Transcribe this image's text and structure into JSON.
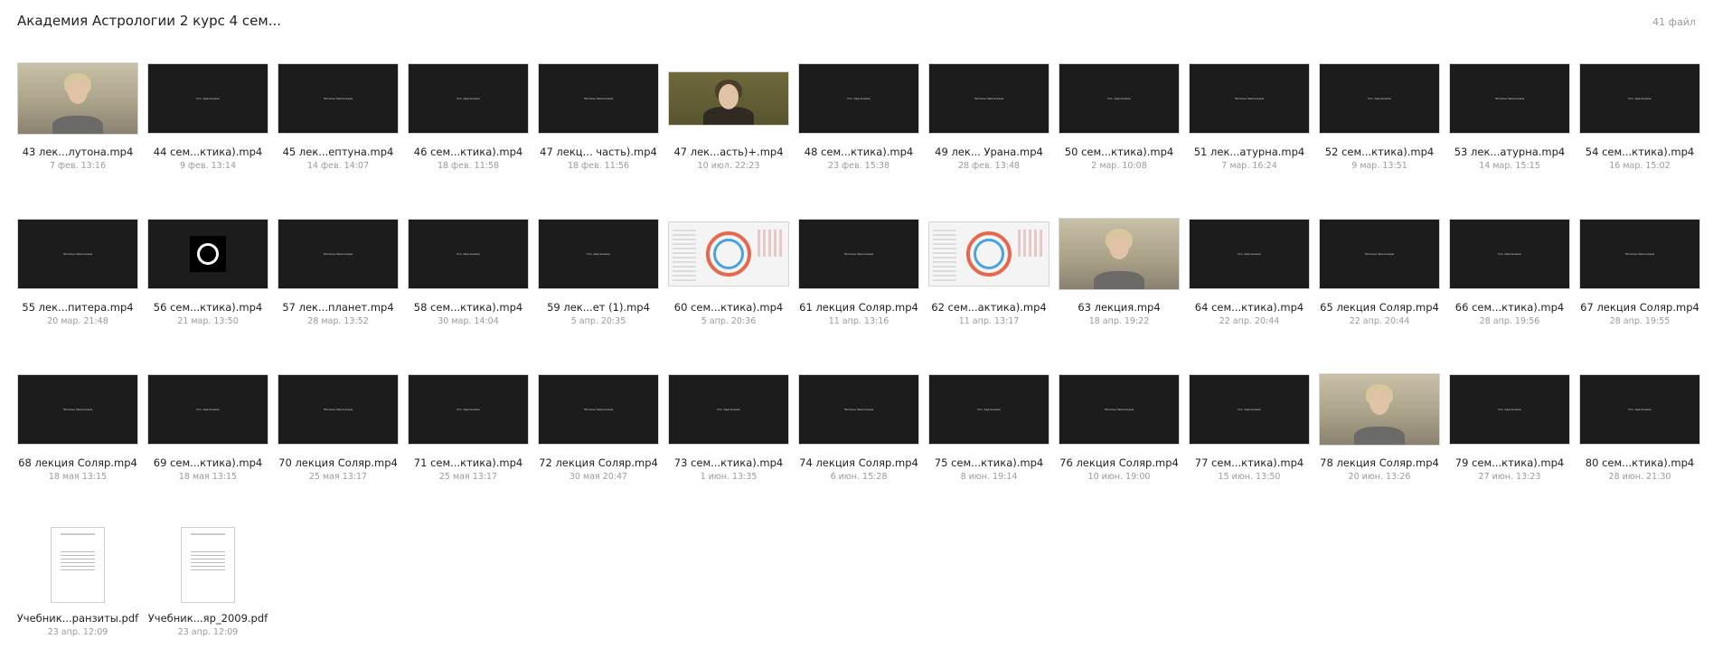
{
  "header": {
    "title": "Академия Астрологии 2 курс 4 сем...",
    "file_count": "41 файл"
  },
  "caption_text": {
    "natalia": "Наталья Хвесечеяна",
    "sem": "Н.А. Хвесечеяна"
  },
  "files": [
    {
      "name": "43 лек...лутона.mp4",
      "date": "7 фев. 13:16",
      "thumb": "webcam"
    },
    {
      "name": "44 сем...ктика).mp4",
      "date": "9 фев. 13:14",
      "thumb": "dark",
      "caption": "sem"
    },
    {
      "name": "45 лек...ептуна.mp4",
      "date": "14 фев. 14:07",
      "thumb": "dark",
      "caption": "natalia"
    },
    {
      "name": "46 сем...ктика).mp4",
      "date": "18 фев. 11:58",
      "thumb": "dark",
      "caption": "sem"
    },
    {
      "name": "47 лекц... часть).mp4",
      "date": "18 фев. 11:56",
      "thumb": "dark",
      "caption": "natalia"
    },
    {
      "name": "47 лек...асть)+.mp4",
      "date": "10 июл. 22:23",
      "thumb": "webcam-dark"
    },
    {
      "name": "48 сем...ктика).mp4",
      "date": "23 фев. 15:38",
      "thumb": "dark",
      "caption": "sem"
    },
    {
      "name": "49 лек... Урана.mp4",
      "date": "28 фев. 13:48",
      "thumb": "dark",
      "caption": "natalia"
    },
    {
      "name": "50 сем...ктика).mp4",
      "date": "2 мар. 10:08",
      "thumb": "dark",
      "caption": "sem"
    },
    {
      "name": "51 лек...атурна.mp4",
      "date": "7 мар. 16:24",
      "thumb": "dark",
      "caption": "natalia"
    },
    {
      "name": "52 сем...ктика).mp4",
      "date": "9 мар. 13:51",
      "thumb": "dark",
      "caption": "sem"
    },
    {
      "name": "53 лек...атурна.mp4",
      "date": "14 мар. 15:15",
      "thumb": "dark",
      "caption": "natalia"
    },
    {
      "name": "54 сем...ктика).mp4",
      "date": "16 мар. 15:02",
      "thumb": "dark",
      "caption": "sem"
    },
    {
      "name": "55 лек...питера.mp4",
      "date": "20 мар. 21:48",
      "thumb": "dark",
      "caption": "natalia"
    },
    {
      "name": "56 сем...ктика).mp4",
      "date": "21 мар. 13:50",
      "thumb": "logo"
    },
    {
      "name": "57 лек...планет.mp4",
      "date": "28 мар. 13:52",
      "thumb": "dark",
      "caption": "natalia"
    },
    {
      "name": "58 сем...ктика).mp4",
      "date": "30 мар. 14:04",
      "thumb": "dark",
      "caption": "sem"
    },
    {
      "name": "59 лек...ет (1).mp4",
      "date": "5 апр. 20:35",
      "thumb": "dark",
      "caption": "sem"
    },
    {
      "name": "60 сем...ктика).mp4",
      "date": "5 апр. 20:36",
      "thumb": "chart"
    },
    {
      "name": "61 лекция Соляр.mp4",
      "date": "11 апр. 13:16",
      "thumb": "dark",
      "caption": "natalia"
    },
    {
      "name": "62 сем...актика).mp4",
      "date": "11 апр. 13:17",
      "thumb": "chart"
    },
    {
      "name": "63 лекция.mp4",
      "date": "18 апр. 19:22",
      "thumb": "webcam"
    },
    {
      "name": "64 сем...ктика).mp4",
      "date": "22 апр. 20:44",
      "thumb": "dark",
      "caption": "sem"
    },
    {
      "name": "65 лекция Соляр.mp4",
      "date": "22 апр. 20:44",
      "thumb": "dark",
      "caption": "natalia"
    },
    {
      "name": "66 сем...ктика).mp4",
      "date": "28 апр. 19:56",
      "thumb": "dark",
      "caption": "sem"
    },
    {
      "name": "67 лекция Соляр.mp4",
      "date": "28 апр. 19:55",
      "thumb": "dark",
      "caption": "natalia"
    },
    {
      "name": "68 лекция Соляр.mp4",
      "date": "18 мая 13:15",
      "thumb": "dark",
      "caption": "natalia"
    },
    {
      "name": "69 сем...ктика).mp4",
      "date": "18 мая 13:15",
      "thumb": "dark",
      "caption": "sem"
    },
    {
      "name": "70 лекция Соляр.mp4",
      "date": "25 мая 13:17",
      "thumb": "dark",
      "caption": "natalia"
    },
    {
      "name": "71 сем...ктика).mp4",
      "date": "25 мая 13:17",
      "thumb": "dark",
      "caption": "sem"
    },
    {
      "name": "72 лекция Соляр.mp4",
      "date": "30 мая 20:47",
      "thumb": "dark",
      "caption": "natalia"
    },
    {
      "name": "73 сем...ктика).mp4",
      "date": "1 июн. 13:35",
      "thumb": "dark",
      "caption": "sem"
    },
    {
      "name": "74 лекция Соляр.mp4",
      "date": "6 июн. 15:28",
      "thumb": "dark",
      "caption": "natalia"
    },
    {
      "name": "75 сем...ктика).mp4",
      "date": "8 июн. 19:14",
      "thumb": "dark",
      "caption": "sem"
    },
    {
      "name": "76 лекция Соляр.mp4",
      "date": "10 июн. 19:00",
      "thumb": "dark",
      "caption": "natalia"
    },
    {
      "name": "77 сем...ктика).mp4",
      "date": "15 июн. 13:50",
      "thumb": "dark",
      "caption": "sem"
    },
    {
      "name": "78 лекция Соляр.mp4",
      "date": "20 июн. 13:26",
      "thumb": "webcam"
    },
    {
      "name": "79 сем...ктика).mp4",
      "date": "27 июн. 13:23",
      "thumb": "dark",
      "caption": "sem"
    },
    {
      "name": "80 сем...ктика).mp4",
      "date": "28 июн. 21:30",
      "thumb": "dark",
      "caption": "sem"
    },
    {
      "name": "Учебник...ранзиты.pdf",
      "date": "23 апр. 12:09",
      "thumb": "pdf"
    },
    {
      "name": "Учебник...яр_2009.pdf",
      "date": "23 апр. 12:09",
      "thumb": "pdf"
    }
  ]
}
